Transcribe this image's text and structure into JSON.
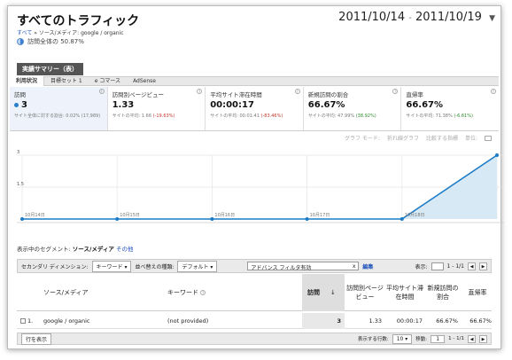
{
  "header": {
    "title": "すべてのトラフィック",
    "date_start": "2011/10/14",
    "date_sep": "-",
    "date_end": "2011/10/19",
    "breadcrumb_root": "すべて",
    "breadcrumb_sep": "»",
    "breadcrumb_path": "ソース/メディア: google / organic",
    "percent_label": "訪問全体の 50.87%"
  },
  "summary": {
    "title": "実績サマリー（表）",
    "tabs": [
      "利用状況",
      "目標セット 1",
      "e コマース",
      "AdSense"
    ]
  },
  "metrics": [
    {
      "label": "訪問",
      "value": "3",
      "sub": "サイト全体に対する割合: 0.02% (17,989)",
      "delta": ""
    },
    {
      "label": "訪問別ページビュー",
      "value": "1.33",
      "sub": "サイトの平均: 1.66",
      "delta": "(-19.63%)"
    },
    {
      "label": "平均サイト滞在時間",
      "value": "00:00:17",
      "sub": "サイトの平均: 00:01:41",
      "delta": "(-83.46%)"
    },
    {
      "label": "新規訪問の割合",
      "value": "66.67%",
      "sub": "サイトの平均: 47.99%",
      "delta": "(38.92%)"
    },
    {
      "label": "直帰率",
      "value": "66.67%",
      "sub": "サイトの平均: 71.38%",
      "delta": "(-6.61%)"
    }
  ],
  "chart_toolbar": {
    "mode_label": "グラフ モード:",
    "mode_value": "折れ線グラフ",
    "compare": "比較する指標",
    "unit": "単位:"
  },
  "chart_data": {
    "type": "area",
    "x": [
      "10月14日",
      "10月15日",
      "10月16日",
      "10月17日",
      "10月18日",
      "10月19日"
    ],
    "series": [
      {
        "values": [
          0,
          0,
          0,
          0,
          0,
          3
        ]
      }
    ],
    "y_ticks": [
      "3",
      "1.5",
      ""
    ],
    "ylim": [
      0,
      3
    ],
    "color": "#1c7bc6",
    "fill": "#d8e9f6"
  },
  "segment": {
    "label": "表示中のセグメント:",
    "current": "ソース/メディア",
    "other": "その他"
  },
  "table_toolbar": {
    "secondary_label": "セカンダリ ディメンション:",
    "secondary_value": "キーワード",
    "sort_label": "並べ替えの種類:",
    "sort_value": "デフォルト",
    "filter_value": "アドバンス フィルタ有効",
    "filter_clear": "x",
    "edit_link": "編集",
    "display_label": "表示:",
    "page_range": "1 - 1/1"
  },
  "table": {
    "headers": [
      "ソース/メディア",
      "キーワード",
      "訪問",
      "訪問別ページビュー",
      "平均サイト滞在時間",
      "新規訪問の割合",
      "直帰率"
    ],
    "rows": [
      {
        "num": "1.",
        "source": "google / organic",
        "keyword": "(not provided)",
        "visits": "3",
        "ppv": "1.33",
        "time": "00:00:17",
        "new": "66.67%",
        "bounce": "66.67%"
      }
    ]
  },
  "footer": {
    "plot_rows": "行を表示",
    "rows_label": "表示する行数:",
    "rows_value": "10",
    "goto_label": "移動:",
    "goto_value": "1",
    "page_range": "1 - 1/1"
  }
}
